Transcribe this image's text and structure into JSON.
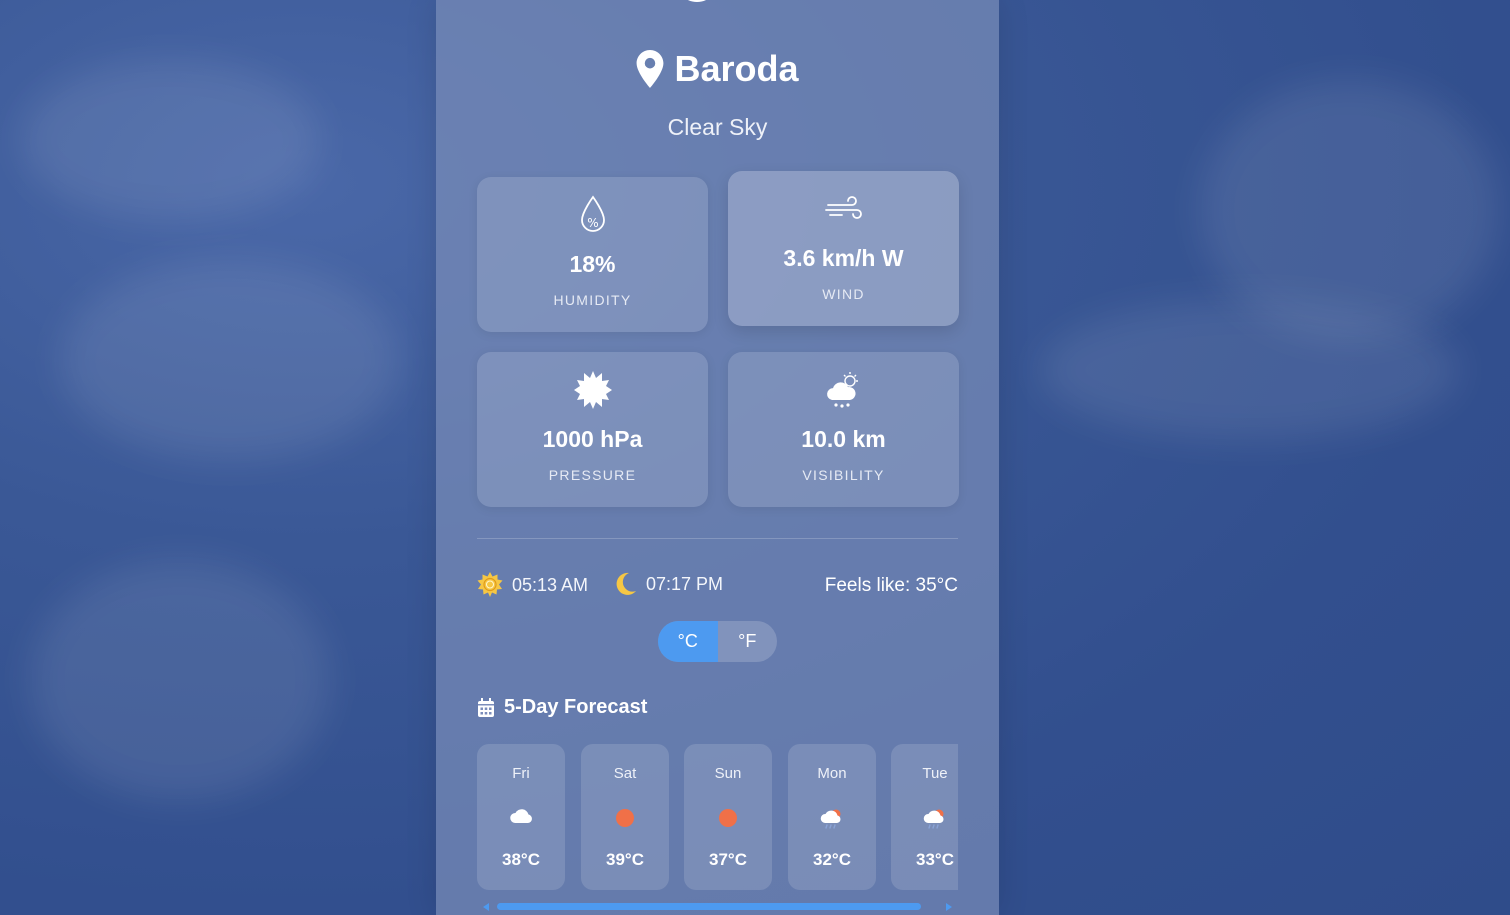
{
  "location": {
    "city": "Baroda",
    "condition": "Clear Sky",
    "icon": "map-pin-icon"
  },
  "stats": [
    {
      "value": "18%",
      "label": "HUMIDITY",
      "icon": "humidity-drop-icon"
    },
    {
      "value": "3.6 km/h W",
      "label": "WIND",
      "icon": "wind-icon"
    },
    {
      "value": "1000 hPa",
      "label": "PRESSURE",
      "icon": "pressure-sun-icon"
    },
    {
      "value": "10.0 km",
      "label": "VISIBILITY",
      "icon": "cloud-sun-rain-icon"
    }
  ],
  "sun": {
    "sunrise": "05:13 AM",
    "sunset": "07:17 PM",
    "feels_like": "Feels like: 35°C",
    "sunrise_icon": "sun-icon",
    "sunset_icon": "moon-icon",
    "icon_color": "#f6c744"
  },
  "units": {
    "celsius": "°C",
    "fahrenheit": "°F",
    "active": "celsius",
    "active_color": "#4d9af0"
  },
  "forecast": {
    "title": "5-Day Forecast",
    "icon": "calendar-icon",
    "days": [
      {
        "day": "Fri",
        "temp": "38°C",
        "icon": "cloud-icon"
      },
      {
        "day": "Sat",
        "temp": "39°C",
        "icon": "sun-icon"
      },
      {
        "day": "Sun",
        "temp": "37°C",
        "icon": "sun-icon"
      },
      {
        "day": "Mon",
        "temp": "32°C",
        "icon": "rain-cloud-sun-icon"
      },
      {
        "day": "Tue",
        "temp": "33°C",
        "icon": "rain-cloud-sun-icon"
      }
    ]
  }
}
